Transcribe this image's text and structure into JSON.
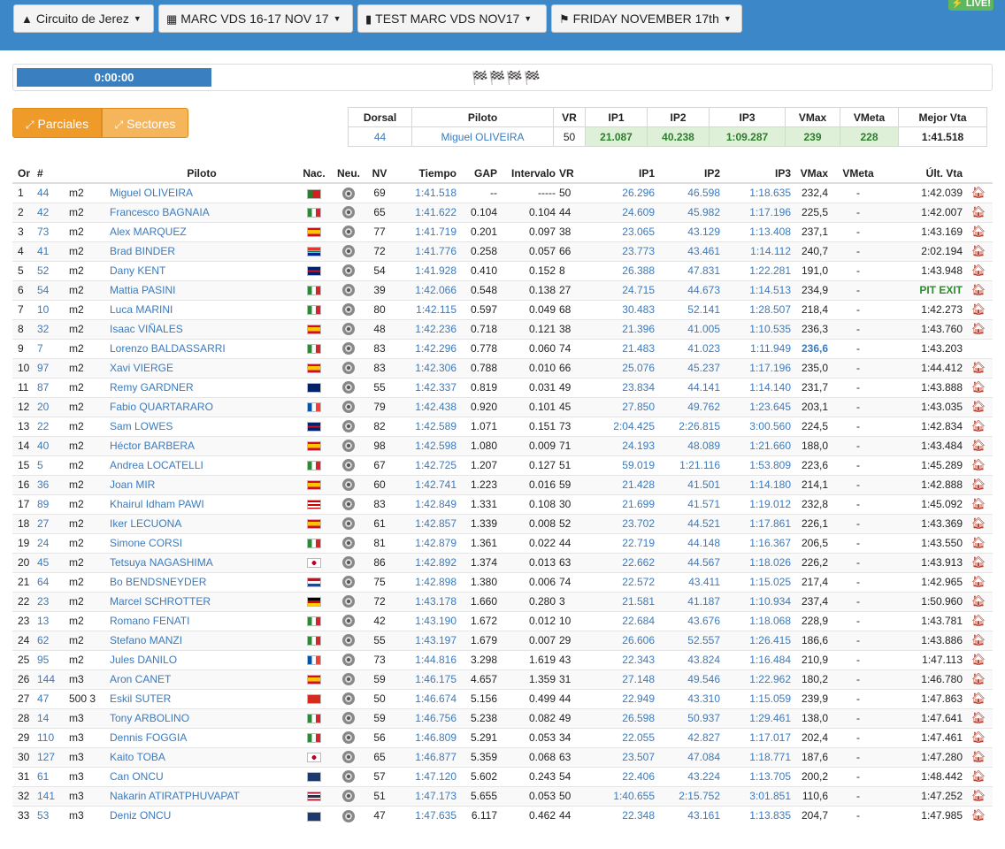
{
  "topbar": {
    "track": "Circuito de Jerez",
    "event": "MARC VDS 16-17 NOV 17",
    "session": "TEST MARC VDS NOV17",
    "day": "FRIDAY NOVEMBER 17th",
    "live": "LIVE!"
  },
  "timer": {
    "value": "0:00:00",
    "flags": "🏁🏁🏁🏁"
  },
  "toggles": {
    "parciales": "Parciales",
    "sectores": "Sectores"
  },
  "best": {
    "headers": [
      "Dorsal",
      "Piloto",
      "VR",
      "IP1",
      "IP2",
      "IP3",
      "VMax",
      "VMeta",
      "Mejor Vta"
    ],
    "row": [
      "44",
      "Miguel OLIVEIRA",
      "50",
      "21.087",
      "40.238",
      "1:09.287",
      "239",
      "228",
      "1:41.518"
    ]
  },
  "columns": [
    "Or",
    "#",
    "",
    "Piloto",
    "Nac.",
    "Neu.",
    "NV",
    "Tiempo",
    "GAP",
    "Intervalo",
    "VR",
    "IP1",
    "IP2",
    "IP3",
    "VMax",
    "VMeta",
    "Últ. Vta",
    ""
  ],
  "colors": {
    "accent": "#3c87c8",
    "orange": "#ef9b2a",
    "live": "#5cb85c",
    "pit": "#2e8b2e"
  },
  "rows": [
    [
      "1",
      "44",
      "m2",
      "Miguel OLIVEIRA",
      "pt",
      "69",
      "1:41.518",
      "--",
      "-----",
      "50",
      "26.296",
      "46.598",
      "1:18.635",
      "232,4",
      "-",
      "1:42.039",
      true
    ],
    [
      "2",
      "42",
      "m2",
      "Francesco BAGNAIA",
      "it",
      "65",
      "1:41.622",
      "0.104",
      "0.104",
      "44",
      "24.609",
      "45.982",
      "1:17.196",
      "225,5",
      "-",
      "1:42.007",
      true
    ],
    [
      "3",
      "73",
      "m2",
      "Alex MARQUEZ",
      "es",
      "77",
      "1:41.719",
      "0.201",
      "0.097",
      "38",
      "23.065",
      "43.129",
      "1:13.408",
      "237,1",
      "-",
      "1:43.169",
      true
    ],
    [
      "4",
      "41",
      "m2",
      "Brad BINDER",
      "za",
      "72",
      "1:41.776",
      "0.258",
      "0.057",
      "66",
      "23.773",
      "43.461",
      "1:14.112",
      "240,7",
      "-",
      "2:02.194",
      true
    ],
    [
      "5",
      "52",
      "m2",
      "Dany KENT",
      "gb",
      "54",
      "1:41.928",
      "0.410",
      "0.152",
      "8",
      "26.388",
      "47.831",
      "1:22.281",
      "191,0",
      "-",
      "1:43.948",
      true
    ],
    [
      "6",
      "54",
      "m2",
      "Mattia PASINI",
      "it",
      "39",
      "1:42.066",
      "0.548",
      "0.138",
      "27",
      "24.715",
      "44.673",
      "1:14.513",
      "234,9",
      "-",
      "PIT EXIT",
      true
    ],
    [
      "7",
      "10",
      "m2",
      "Luca MARINI",
      "it",
      "80",
      "1:42.115",
      "0.597",
      "0.049",
      "68",
      "30.483",
      "52.141",
      "1:28.507",
      "218,4",
      "-",
      "1:42.273",
      true
    ],
    [
      "8",
      "32",
      "m2",
      "Isaac VIÑALES",
      "es",
      "48",
      "1:42.236",
      "0.718",
      "0.121",
      "38",
      "21.396",
      "41.005",
      "1:10.535",
      "236,3",
      "-",
      "1:43.760",
      true
    ],
    [
      "9",
      "7",
      "m2",
      "Lorenzo BALDASSARRI",
      "it",
      "83",
      "1:42.296",
      "0.778",
      "0.060",
      "74",
      "21.483",
      "41.023",
      "1:11.949",
      "236,6",
      "-",
      "1:43.203",
      false
    ],
    [
      "10",
      "97",
      "m2",
      "Xavi VIERGE",
      "es",
      "83",
      "1:42.306",
      "0.788",
      "0.010",
      "66",
      "25.076",
      "45.237",
      "1:17.196",
      "235,0",
      "-",
      "1:44.412",
      true
    ],
    [
      "11",
      "87",
      "m2",
      "Remy GARDNER",
      "au",
      "55",
      "1:42.337",
      "0.819",
      "0.031",
      "49",
      "23.834",
      "44.141",
      "1:14.140",
      "231,7",
      "-",
      "1:43.888",
      true
    ],
    [
      "12",
      "20",
      "m2",
      "Fabio QUARTARARO",
      "fr",
      "79",
      "1:42.438",
      "0.920",
      "0.101",
      "45",
      "27.850",
      "49.762",
      "1:23.645",
      "203,1",
      "-",
      "1:43.035",
      true
    ],
    [
      "13",
      "22",
      "m2",
      "Sam LOWES",
      "gb",
      "82",
      "1:42.589",
      "1.071",
      "0.151",
      "73",
      "2:04.425",
      "2:26.815",
      "3:00.560",
      "224,5",
      "-",
      "1:42.834",
      true
    ],
    [
      "14",
      "40",
      "m2",
      "Héctor BARBERA",
      "es",
      "98",
      "1:42.598",
      "1.080",
      "0.009",
      "71",
      "24.193",
      "48.089",
      "1:21.660",
      "188,0",
      "-",
      "1:43.484",
      true
    ],
    [
      "15",
      "5",
      "m2",
      "Andrea LOCATELLI",
      "it",
      "67",
      "1:42.725",
      "1.207",
      "0.127",
      "51",
      "59.019",
      "1:21.116",
      "1:53.809",
      "223,6",
      "-",
      "1:45.289",
      true
    ],
    [
      "16",
      "36",
      "m2",
      "Joan MIR",
      "es",
      "60",
      "1:42.741",
      "1.223",
      "0.016",
      "59",
      "21.428",
      "41.501",
      "1:14.180",
      "214,1",
      "-",
      "1:42.888",
      true
    ],
    [
      "17",
      "89",
      "m2",
      "Khairul Idham PAWI",
      "my",
      "83",
      "1:42.849",
      "1.331",
      "0.108",
      "30",
      "21.699",
      "41.571",
      "1:19.012",
      "232,8",
      "-",
      "1:45.092",
      true
    ],
    [
      "18",
      "27",
      "m2",
      "Iker LECUONA",
      "es",
      "61",
      "1:42.857",
      "1.339",
      "0.008",
      "52",
      "23.702",
      "44.521",
      "1:17.861",
      "226,1",
      "-",
      "1:43.369",
      true
    ],
    [
      "19",
      "24",
      "m2",
      "Simone CORSI",
      "it",
      "81",
      "1:42.879",
      "1.361",
      "0.022",
      "44",
      "22.719",
      "44.148",
      "1:16.367",
      "206,5",
      "-",
      "1:43.550",
      true
    ],
    [
      "20",
      "45",
      "m2",
      "Tetsuya NAGASHIMA",
      "jp",
      "86",
      "1:42.892",
      "1.374",
      "0.013",
      "63",
      "22.662",
      "44.567",
      "1:18.026",
      "226,2",
      "-",
      "1:43.913",
      true
    ],
    [
      "21",
      "64",
      "m2",
      "Bo BENDSNEYDER",
      "nl",
      "75",
      "1:42.898",
      "1.380",
      "0.006",
      "74",
      "22.572",
      "43.411",
      "1:15.025",
      "217,4",
      "-",
      "1:42.965",
      true
    ],
    [
      "22",
      "23",
      "m2",
      "Marcel SCHROTTER",
      "de",
      "72",
      "1:43.178",
      "1.660",
      "0.280",
      "3",
      "21.581",
      "41.187",
      "1:10.934",
      "237,4",
      "-",
      "1:50.960",
      true
    ],
    [
      "23",
      "13",
      "m2",
      "Romano FENATI",
      "it",
      "42",
      "1:43.190",
      "1.672",
      "0.012",
      "10",
      "22.684",
      "43.676",
      "1:18.068",
      "228,9",
      "-",
      "1:43.781",
      true
    ],
    [
      "24",
      "62",
      "m2",
      "Stefano MANZI",
      "it",
      "55",
      "1:43.197",
      "1.679",
      "0.007",
      "29",
      "26.606",
      "52.557",
      "1:26.415",
      "186,6",
      "-",
      "1:43.886",
      true
    ],
    [
      "25",
      "95",
      "m2",
      "Jules DANILO",
      "fr",
      "73",
      "1:44.816",
      "3.298",
      "1.619",
      "43",
      "22.343",
      "43.824",
      "1:16.484",
      "210,9",
      "-",
      "1:47.113",
      true
    ],
    [
      "26",
      "144",
      "m3",
      "Aron CANET",
      "es",
      "59",
      "1:46.175",
      "4.657",
      "1.359",
      "31",
      "27.148",
      "49.546",
      "1:22.962",
      "180,2",
      "-",
      "1:46.780",
      true
    ],
    [
      "27",
      "47",
      "500 3",
      "Eskil SUTER",
      "ch",
      "50",
      "1:46.674",
      "5.156",
      "0.499",
      "44",
      "22.949",
      "43.310",
      "1:15.059",
      "239,9",
      "-",
      "1:47.863",
      true
    ],
    [
      "28",
      "14",
      "m3",
      "Tony ARBOLINO",
      "it",
      "59",
      "1:46.756",
      "5.238",
      "0.082",
      "49",
      "26.598",
      "50.937",
      "1:29.461",
      "138,0",
      "-",
      "1:47.641",
      true
    ],
    [
      "29",
      "110",
      "m3",
      "Dennis FOGGIA",
      "it",
      "56",
      "1:46.809",
      "5.291",
      "0.053",
      "34",
      "22.055",
      "42.827",
      "1:17.017",
      "202,4",
      "-",
      "1:47.461",
      true
    ],
    [
      "30",
      "127",
      "m3",
      "Kaito TOBA",
      "jp",
      "65",
      "1:46.877",
      "5.359",
      "0.068",
      "63",
      "23.507",
      "47.084",
      "1:18.771",
      "187,6",
      "-",
      "1:47.280",
      true
    ],
    [
      "31",
      "61",
      "m3",
      "Can ONCU",
      "tr",
      "57",
      "1:47.120",
      "5.602",
      "0.243",
      "54",
      "22.406",
      "43.224",
      "1:13.705",
      "200,2",
      "-",
      "1:48.442",
      true
    ],
    [
      "32",
      "141",
      "m3",
      "Nakarin ATIRATPHUVAPAT",
      "th",
      "51",
      "1:47.173",
      "5.655",
      "0.053",
      "50",
      "1:40.655",
      "2:15.752",
      "3:01.851",
      "110,6",
      "-",
      "1:47.252",
      true
    ],
    [
      "33",
      "53",
      "m3",
      "Deniz ONCU",
      "tr",
      "47",
      "1:47.635",
      "6.117",
      "0.462",
      "44",
      "22.348",
      "43.161",
      "1:13.835",
      "204,7",
      "-",
      "1:47.985",
      true
    ]
  ]
}
